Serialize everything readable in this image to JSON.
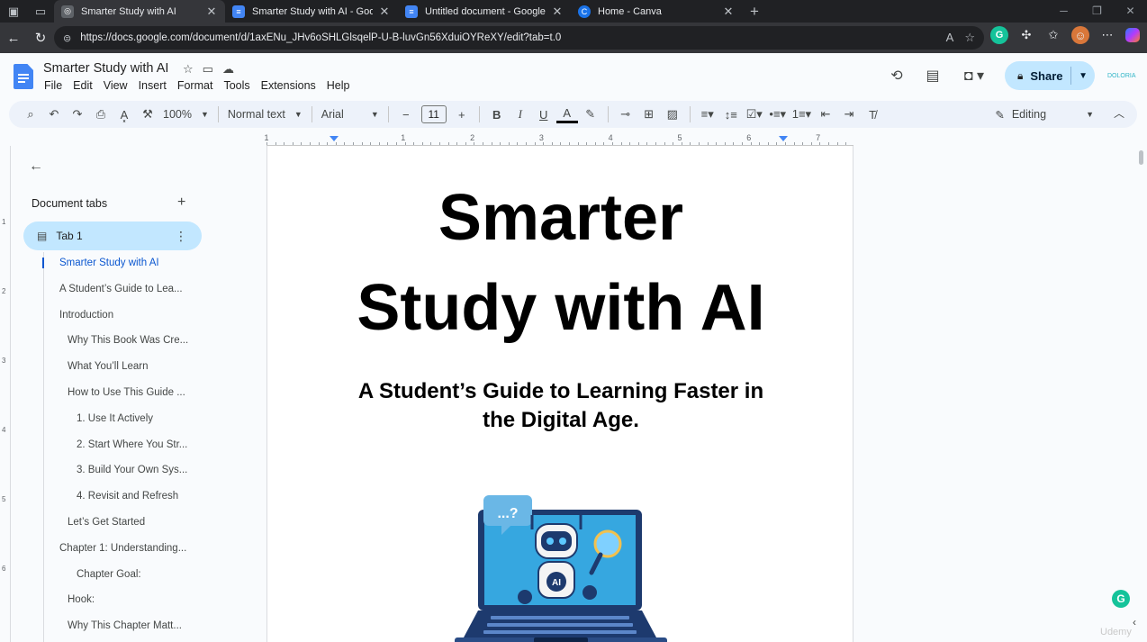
{
  "browser": {
    "tabs": [
      {
        "title": "Smarter Study with AI",
        "active": true
      },
      {
        "title": "Smarter Study with AI - Google D",
        "active": false
      },
      {
        "title": "Untitled document - Google Docs",
        "active": false
      },
      {
        "title": "Home - Canva",
        "active": false
      }
    ],
    "url": "https://docs.google.com/document/d/1axENu_JHv6oSHLGlsqelP-U-B-luvGn56XduiOYReXY/edit?tab=t.0"
  },
  "doc": {
    "title": "Smarter Study with AI",
    "menu": [
      "File",
      "Edit",
      "View",
      "Insert",
      "Format",
      "Tools",
      "Extensions",
      "Help"
    ],
    "share_label": "Share",
    "brand_mini": "DOLORIA"
  },
  "toolbar": {
    "zoom": "100%",
    "style": "Normal text",
    "font": "Arial",
    "font_size": "11",
    "mode": "Editing"
  },
  "ruler": {
    "labels": [
      "1",
      "1",
      "2",
      "3",
      "4",
      "5",
      "6",
      "7"
    ],
    "vertical_labels": [
      "1",
      "2",
      "3",
      "4",
      "5",
      "6"
    ]
  },
  "sidebar": {
    "heading": "Document tabs",
    "tab_label": "Tab 1",
    "outline": [
      {
        "text": "Smarter Study with AI",
        "level": 0,
        "active": true
      },
      {
        "text": "A Student’s Guide to Lea...",
        "level": 0
      },
      {
        "text": "Introduction",
        "level": 0
      },
      {
        "text": "Why This Book Was Cre...",
        "level": 1
      },
      {
        "text": "What You’ll Learn",
        "level": 1
      },
      {
        "text": "How to Use This Guide ...",
        "level": 1
      },
      {
        "text": "1. Use It Actively",
        "level": 2
      },
      {
        "text": "2. Start Where You Str...",
        "level": 2
      },
      {
        "text": "3. Build Your Own Sys...",
        "level": 2
      },
      {
        "text": "4. Revisit and Refresh",
        "level": 2
      },
      {
        "text": "Let’s Get Started",
        "level": 1
      },
      {
        "text": "Chapter 1: Understanding...",
        "level": 0
      },
      {
        "text": "Chapter Goal:",
        "level": 2
      },
      {
        "text": "Hook:",
        "level": 1
      },
      {
        "text": "Why This Chapter Matt...",
        "level": 1
      }
    ]
  },
  "page": {
    "title_line1": "Smarter",
    "title_line2": "Study with AI",
    "subtitle": "A Student’s Guide to Learning Faster in the Digital Age.",
    "illustration_text": "AI",
    "bubble_text": "...?"
  },
  "watermark": "Udemy"
}
